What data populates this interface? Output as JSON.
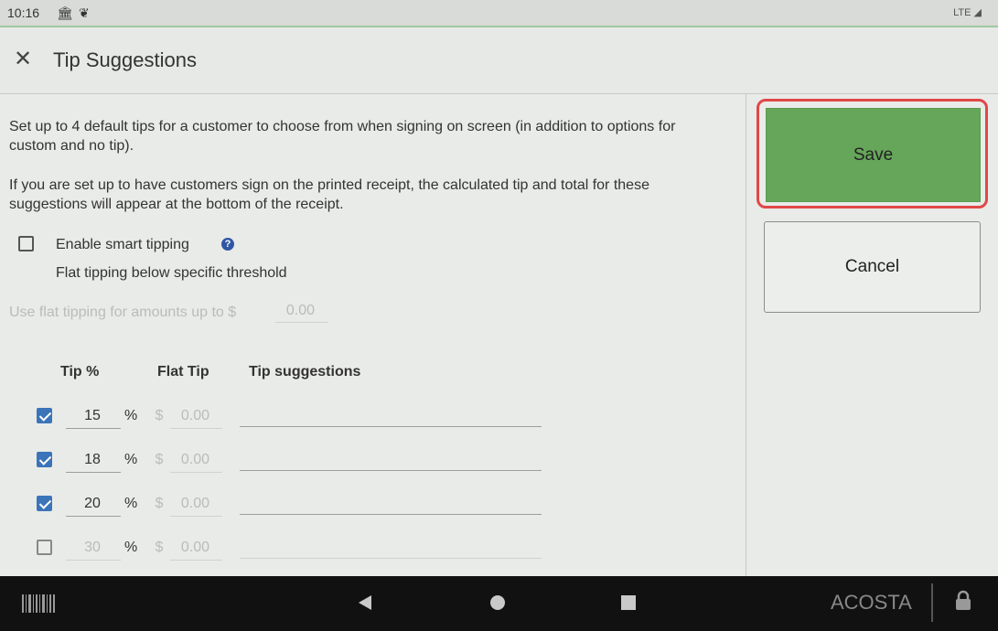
{
  "status_bar": {
    "time": "10:16",
    "icons": [
      "bank-icon",
      "butterfly-icon"
    ],
    "network": "LTE"
  },
  "header": {
    "close_icon": "close-icon",
    "title": "Tip Suggestions"
  },
  "content": {
    "description_1": "Set up to 4 default tips for a customer to choose from when signing on screen (in addition to options for custom and no tip).",
    "description_2": "If you are set up to have customers sign on the printed receipt, the calculated tip and total for these suggestions will appear at the bottom of the receipt.",
    "smart_tipping": {
      "label": "Enable smart tipping",
      "checked": false,
      "help_icon": "?",
      "sublabel": "Flat tipping below specific threshold"
    },
    "flat_threshold": {
      "label": "Use flat tipping for amounts up to $",
      "value": "0.00"
    },
    "table": {
      "headers": {
        "tip_pct": "Tip %",
        "flat_tip": "Flat Tip",
        "suggestions": "Tip suggestions"
      },
      "percent_sign": "%",
      "dollar_sign": "$",
      "rows": [
        {
          "checked": true,
          "pct": "15",
          "flat": "0.00",
          "suggestion": ""
        },
        {
          "checked": true,
          "pct": "18",
          "flat": "0.00",
          "suggestion": ""
        },
        {
          "checked": true,
          "pct": "20",
          "flat": "0.00",
          "suggestion": ""
        },
        {
          "checked": false,
          "pct": "30",
          "flat": "0.00",
          "suggestion": ""
        }
      ]
    }
  },
  "actions": {
    "save_label": "Save",
    "cancel_label": "Cancel"
  },
  "nav_bar": {
    "user": "ACOSTA",
    "icons": [
      "barcode-icon",
      "back-icon",
      "home-icon",
      "recents-icon",
      "lock-icon"
    ]
  },
  "colors": {
    "save_green": "#66a65a",
    "highlight_red": "#e04848",
    "checkbox_blue": "#3b74b9"
  }
}
